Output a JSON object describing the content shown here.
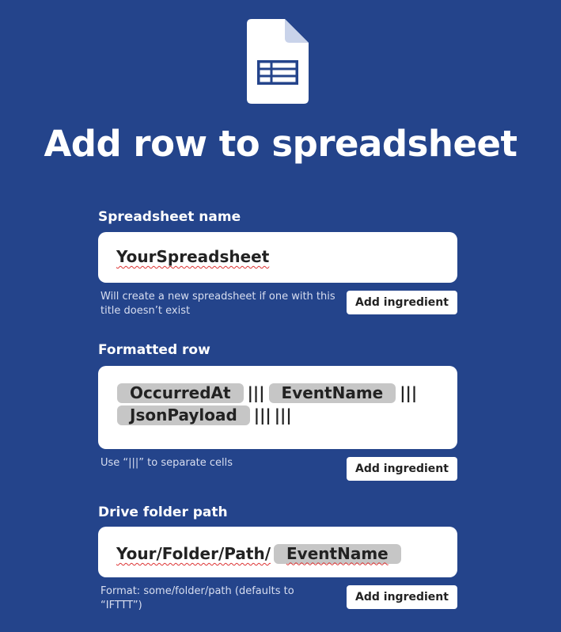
{
  "icon": "spreadsheet-icon",
  "title": "Add row to spreadsheet",
  "colors": {
    "background": "#24448b",
    "pill": "#c6c6c6",
    "field": "#ffffff",
    "text": "#222222"
  },
  "fields": {
    "spreadsheet_name": {
      "label": "Spreadsheet name",
      "value": "YourSpreadsheet",
      "helper": "Will create a new spreadsheet if one with this title doesn’t exist",
      "button": "Add ingredient"
    },
    "formatted_row": {
      "label": "Formatted row",
      "ingredients": [
        "OccurredAt",
        "EventName",
        "JsonPayload"
      ],
      "separator": "|||",
      "helper": "Use “|||” to separate cells",
      "button": "Add ingredient"
    },
    "drive_folder_path": {
      "label": "Drive folder path",
      "value": "Your/Folder/Path/",
      "ingredient": "EventName",
      "helper": "Format: some/folder/path (defaults to “IFTTT”)",
      "button": "Add ingredient"
    }
  }
}
